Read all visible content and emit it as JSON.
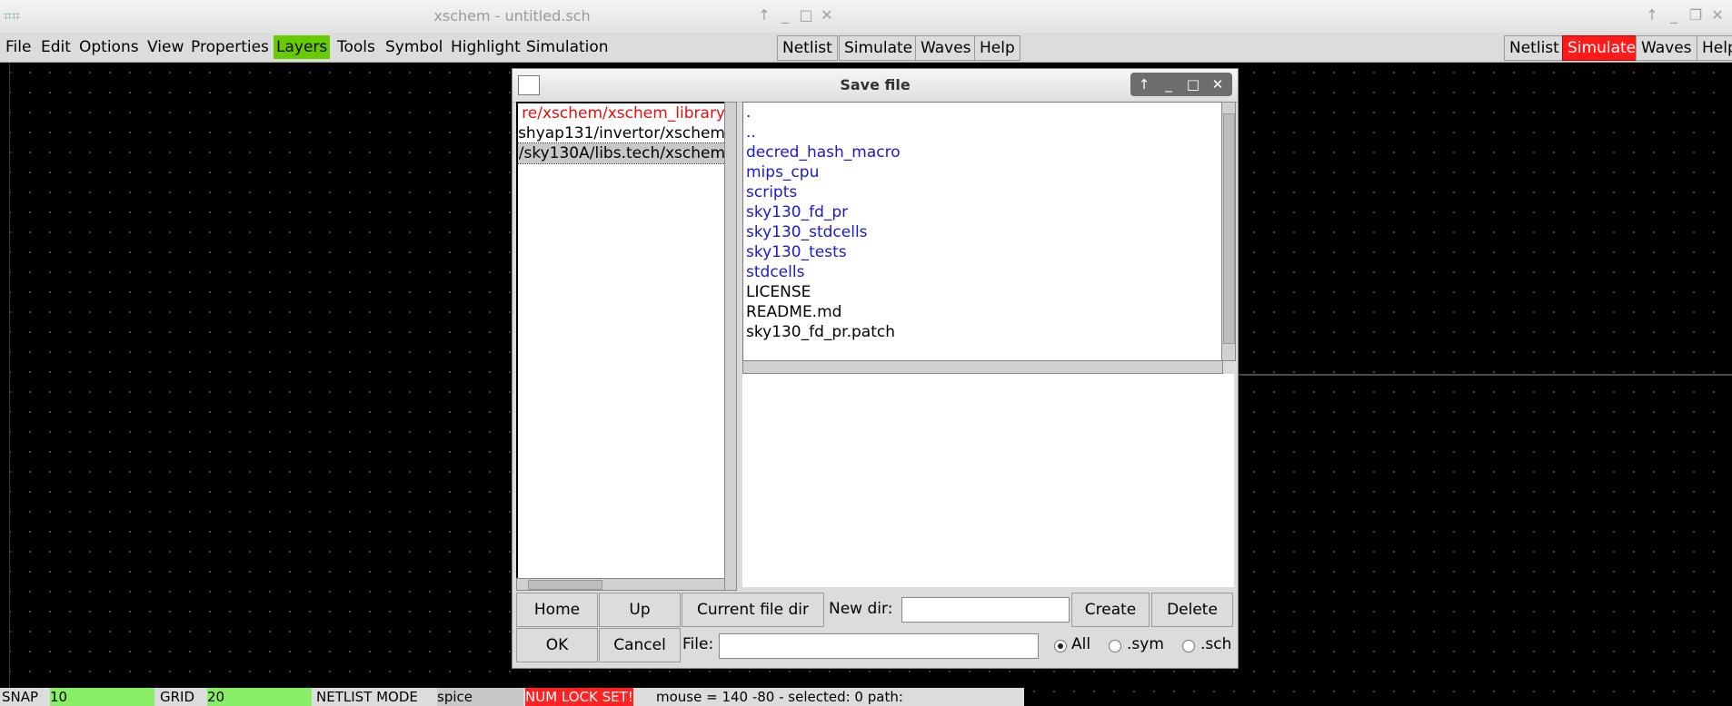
{
  "left_window": {
    "title": "xschem - untitled.sch",
    "menus": [
      "File",
      "Edit",
      "Options",
      "View",
      "Properties",
      "Layers",
      "Tools",
      "Symbol",
      "Highlight",
      "Simulation"
    ],
    "buttons": [
      "Netlist",
      "Simulate",
      "Waves",
      "Help"
    ],
    "status": {
      "snap_label": "SNAP",
      "snap_value": "10",
      "grid_label": "GRID",
      "grid_value": "20",
      "netlist_label": "NETLIST MODE",
      "netlist_value": "spice",
      "numlock": "NUM LOCK SET!",
      "info": "mouse = 140 -80 - selected: 0 path:"
    }
  },
  "right_window": {
    "buttons": [
      "Netlist",
      "Simulate",
      "Waves",
      "Help"
    ]
  },
  "dialog": {
    "title": "Save file",
    "dirs": [
      "re/xschem/xschem_library",
      "shyap131/invertor/xschem",
      "/sky130A/libs.tech/xschem"
    ],
    "files": [
      ".",
      "..",
      "decred_hash_macro",
      "mips_cpu",
      "scripts",
      "sky130_fd_pr",
      "sky130_stdcells",
      "sky130_tests",
      "stdcells",
      "LICENSE",
      "README.md",
      "sky130_fd_pr.patch"
    ],
    "buttons": {
      "home": "Home",
      "up": "Up",
      "current": "Current file dir",
      "newdir_label": "New dir:",
      "create": "Create",
      "delete": "Delete",
      "ok": "OK",
      "cancel": "Cancel",
      "file_label": "File:"
    },
    "filters": [
      "All",
      ".sym",
      ".sch"
    ],
    "selected_filter": "All"
  },
  "colors": {
    "layers_highlight": "#66cc00",
    "simulate_active": "#ff1a1a",
    "directory_text": "#1a1acc",
    "dir_red": "#e01010"
  }
}
